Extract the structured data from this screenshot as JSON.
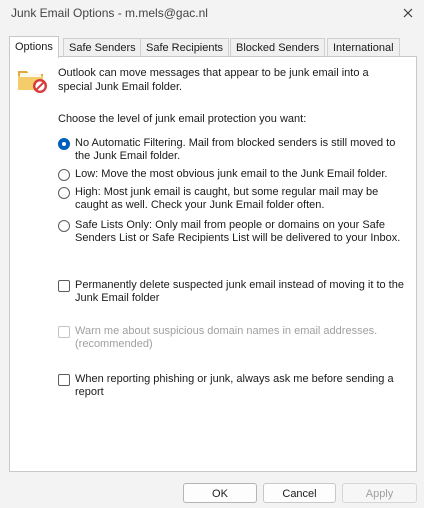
{
  "window": {
    "title": "Junk Email Options - m.mels@gac.nl",
    "close_icon": "close-icon"
  },
  "tabs": [
    {
      "label": "Options",
      "active": true
    },
    {
      "label": "Safe Senders",
      "active": false
    },
    {
      "label": "Safe Recipients",
      "active": false
    },
    {
      "label": "Blocked Senders",
      "active": false
    },
    {
      "label": "International",
      "active": false
    }
  ],
  "panel": {
    "icon": "junk-folder-icon",
    "intro": "Outlook can move messages that appear to be junk email into a special Junk Email folder.",
    "level_label": "Choose the level of junk email protection you want:",
    "levels": [
      {
        "label": "No Automatic Filtering. Mail from blocked senders is still moved to the Junk Email folder.",
        "selected": true
      },
      {
        "label": "Low: Move the most obvious junk email to the Junk Email folder.",
        "selected": false
      },
      {
        "label": "High: Most junk email is caught, but some regular mail may be caught as well. Check your Junk Email folder often.",
        "selected": false
      },
      {
        "label": "Safe Lists Only: Only mail from people or domains on your Safe Senders List or Safe Recipients List will be delivered to your Inbox.",
        "selected": false
      }
    ],
    "options": [
      {
        "label": "Permanently delete suspected junk email instead of moving it to the Junk Email folder",
        "checked": false,
        "enabled": true
      },
      {
        "label": "Warn me about suspicious domain names in email addresses. (recommended)",
        "checked": false,
        "enabled": false
      },
      {
        "label": "When reporting phishing or junk, always ask me before sending a report",
        "checked": false,
        "enabled": true
      }
    ]
  },
  "buttons": {
    "ok": "OK",
    "cancel": "Cancel",
    "apply": "Apply"
  },
  "colors": {
    "accent": "#005fb8",
    "folder": "#e8b64c",
    "no_entry": "#d83b3b"
  }
}
